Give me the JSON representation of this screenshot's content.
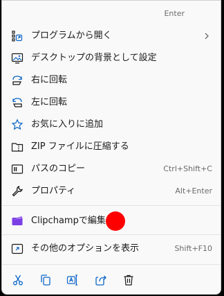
{
  "menu": {
    "top_shortcut": "Enter",
    "items": [
      {
        "label": "プログラムから開く",
        "shortcut": "",
        "has_submenu": true
      },
      {
        "label": "デスクトップの背景として設定",
        "shortcut": ""
      },
      {
        "label": "右に回転",
        "shortcut": ""
      },
      {
        "label": "左に回転",
        "shortcut": ""
      },
      {
        "label": "お気に入りに追加",
        "shortcut": ""
      },
      {
        "label": "ZIP ファイルに圧縮する",
        "shortcut": ""
      },
      {
        "label": "パスのコピー",
        "shortcut": "Ctrl+Shift+C"
      },
      {
        "label": "プロパティ",
        "shortcut": "Alt+Enter"
      },
      {
        "label": "Clipchampで編集",
        "shortcut": ""
      },
      {
        "label": "その他のオプションを表示",
        "shortcut": "Shift+F10"
      }
    ],
    "bottom_actions": [
      "cut-icon",
      "copy-icon",
      "rename-icon",
      "share-icon",
      "delete-icon"
    ]
  },
  "colors": {
    "accent": "#0a64c8",
    "marker": "#ff0000",
    "clipchamp": "#7b3fe4"
  }
}
